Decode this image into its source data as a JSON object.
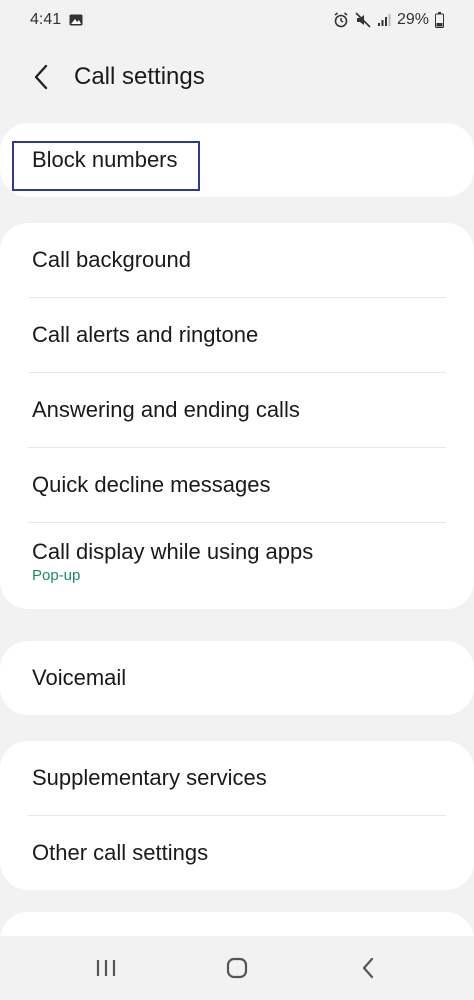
{
  "status_bar": {
    "time": "4:41",
    "battery": "29%",
    "icons": [
      "image-icon",
      "alarm-icon",
      "mute-icon",
      "signal-icon",
      "battery-icon"
    ]
  },
  "header": {
    "title": "Call settings",
    "back_icon": "back-arrow-icon"
  },
  "sections": [
    {
      "items": [
        {
          "label": "Block numbers"
        }
      ]
    },
    {
      "items": [
        {
          "label": "Call background"
        },
        {
          "label": "Call alerts and ringtone"
        },
        {
          "label": "Answering and ending calls"
        },
        {
          "label": "Quick decline messages"
        },
        {
          "label": "Call display while using apps",
          "sub": "Pop-up"
        }
      ]
    },
    {
      "items": [
        {
          "label": "Voicemail"
        }
      ]
    },
    {
      "items": [
        {
          "label": "Supplementary services"
        },
        {
          "label": "Other call settings"
        }
      ]
    }
  ],
  "nav_bar": {
    "icons": [
      "recent-apps-icon",
      "home-icon",
      "back-icon"
    ]
  },
  "colors": {
    "accent_sub": "#1a8a6a",
    "highlight": "#2c3a8f",
    "background": "#f2f2f2",
    "card": "#ffffff"
  }
}
